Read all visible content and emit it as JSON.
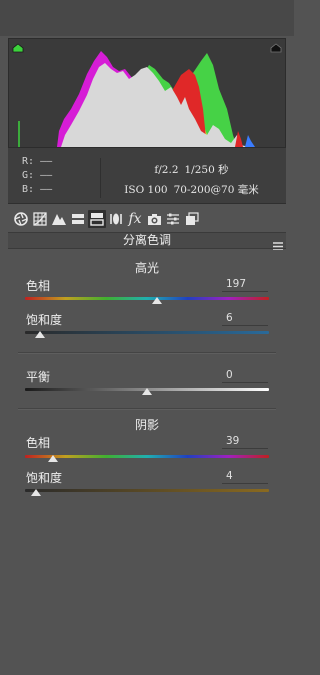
{
  "info": {
    "r_label": "R:",
    "r_value": "——",
    "g_label": "G:",
    "g_value": "——",
    "b_label": "B:",
    "b_value": "——",
    "aperture": "f/2.2",
    "shutter": "1/250 秒",
    "iso": "ISO 100",
    "lens": "70-200@70 毫米"
  },
  "toolbar": {
    "items": [
      "basic-aperture",
      "tone-curve-grid",
      "detail-mountain",
      "hsl",
      "split-toning",
      "lens-corrections",
      "effects-fx",
      "camera-calibration",
      "presets-sliders",
      "snapshots"
    ],
    "active": "split-toning",
    "fx_label": "fx"
  },
  "panel": {
    "title": "分离色调"
  },
  "highlights": {
    "title": "高光",
    "hue_label": "色相",
    "hue_value": "197",
    "saturation_label": "饱和度",
    "saturation_value": "6"
  },
  "balance": {
    "label": "平衡",
    "value": "0"
  },
  "shadows": {
    "title": "阴影",
    "hue_label": "色相",
    "hue_value": "39",
    "saturation_label": "饱和度",
    "saturation_value": "4"
  },
  "colors": {
    "background": "#535353",
    "clip_shadow": "#3cd23c",
    "clip_highlight": "#111111"
  }
}
